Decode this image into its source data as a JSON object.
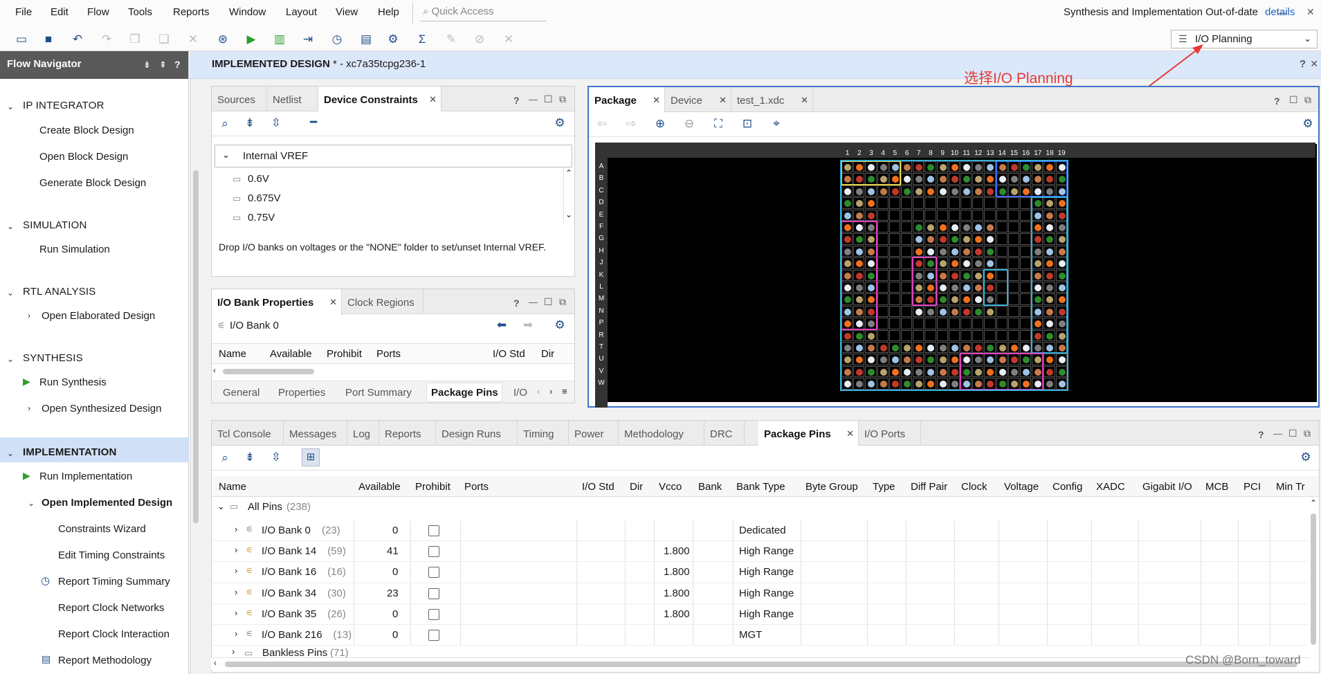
{
  "menu": [
    "File",
    "Edit",
    "Flow",
    "Tools",
    "Reports",
    "Window",
    "Layout",
    "View",
    "Help"
  ],
  "quick_access_placeholder": "Quick Access",
  "status": {
    "text": "Synthesis and Implementation Out-of-date",
    "link": "details"
  },
  "layout_selector": "I/O Planning",
  "flow_navigator": {
    "title": "Flow Navigator",
    "sections": [
      {
        "label": "IP INTEGRATOR",
        "items": [
          "Create Block Design",
          "Open Block Design",
          "Generate Block Design"
        ]
      },
      {
        "label": "SIMULATION",
        "items": [
          "Run Simulation"
        ]
      },
      {
        "label": "RTL ANALYSIS",
        "items": [
          "Open Elaborated Design"
        ]
      },
      {
        "label": "SYNTHESIS",
        "items": [
          "Run Synthesis",
          "Open Synthesized Design"
        ]
      },
      {
        "label": "IMPLEMENTATION",
        "items": [
          "Run Implementation",
          "Open Implemented Design",
          "Constraints Wizard",
          "Edit Timing Constraints",
          "Report Timing Summary",
          "Report Clock Networks",
          "Report Clock Interaction",
          "Report Methodology"
        ]
      }
    ]
  },
  "design": {
    "title": "IMPLEMENTED DESIGN",
    "suffix": " * - xc7a35tcpg236-1"
  },
  "annotation": "选择I/O Planning",
  "watermark": "CSDN @Born_toward",
  "device_constraints": {
    "tabs": [
      "Sources",
      "Netlist",
      "Device Constraints"
    ],
    "group": "Internal VREF",
    "items": [
      "0.6V",
      "0.675V",
      "0.75V"
    ],
    "hint": "Drop I/O banks on voltages or the \"NONE\" folder to set/unset Internal VREF."
  },
  "io_bank_props": {
    "tabs": [
      "I/O Bank Properties",
      "Clock Regions"
    ],
    "bank": "I/O Bank 0",
    "columns": [
      "Name",
      "Available",
      "Prohibit",
      "Ports",
      "I/O Std",
      "Dir"
    ],
    "bottom_tabs": [
      "General",
      "Properties",
      "Port Summary",
      "Package Pins",
      "I/O"
    ]
  },
  "package": {
    "tabs": [
      "Package",
      "Device",
      "test_1.xdc"
    ],
    "cols": [
      "1",
      "2",
      "3",
      "4",
      "5",
      "6",
      "7",
      "8",
      "9",
      "10",
      "11",
      "12",
      "13",
      "14",
      "15",
      "16",
      "17",
      "18",
      "19"
    ],
    "rows": [
      "A",
      "B",
      "C",
      "D",
      "E",
      "F",
      "G",
      "H",
      "J",
      "K",
      "L",
      "M",
      "N",
      "P",
      "R",
      "T",
      "U",
      "V",
      "W"
    ]
  },
  "bottom": {
    "tabs": [
      "Tcl Console",
      "Messages",
      "Log",
      "Reports",
      "Design Runs",
      "Timing",
      "Power",
      "Methodology",
      "DRC",
      "Package Pins",
      "I/O Ports"
    ],
    "columns": [
      "Name",
      "Available",
      "Prohibit",
      "Ports",
      "I/O Std",
      "Dir",
      "Vcco",
      "Bank",
      "Bank Type",
      "Byte Group",
      "Type",
      "Diff Pair",
      "Clock",
      "Voltage",
      "Config",
      "XADC",
      "Gigabit I/O",
      "MCB",
      "PCI",
      "Min Tr"
    ],
    "all_pins": {
      "label": "All Pins",
      "count": "(238)"
    },
    "rows": [
      {
        "name": "I/O Bank 0",
        "count": "(23)",
        "available": "0",
        "vcco": "",
        "bank_type": "Dedicated"
      },
      {
        "name": "I/O Bank 14",
        "count": "(59)",
        "available": "41",
        "vcco": "1.800",
        "bank_type": "High Range"
      },
      {
        "name": "I/O Bank 16",
        "count": "(16)",
        "available": "0",
        "vcco": "1.800",
        "bank_type": "High Range"
      },
      {
        "name": "I/O Bank 34",
        "count": "(30)",
        "available": "23",
        "vcco": "1.800",
        "bank_type": "High Range"
      },
      {
        "name": "I/O Bank 35",
        "count": "(26)",
        "available": "0",
        "vcco": "1.800",
        "bank_type": "High Range"
      },
      {
        "name": "I/O Bank 216",
        "count": "(13)",
        "available": "0",
        "vcco": "",
        "bank_type": "MGT"
      }
    ],
    "last_row": {
      "name": "Bankless Pins",
      "count": "(71)"
    }
  },
  "colors": {
    "accent": "#1f4e8a",
    "selected_section": "#cfe0f7",
    "design_bar": "#dbe8fa",
    "run_green": "#2e9e2e",
    "annotation": "#e53935"
  }
}
